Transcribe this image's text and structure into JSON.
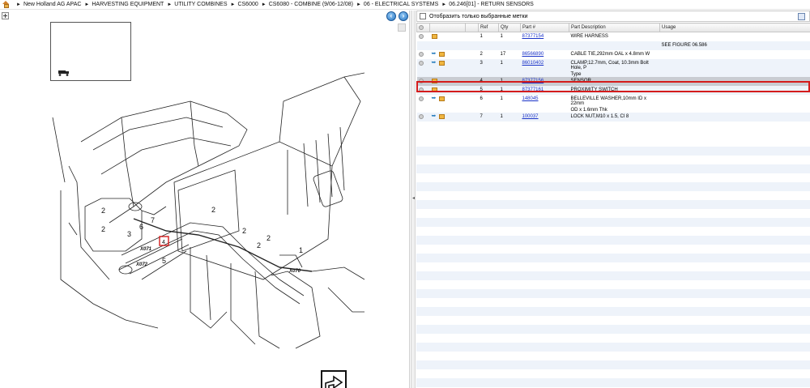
{
  "breadcrumb": [
    "New Holland AG APAC",
    "HARVESTING EQUIPMENT",
    "UTILITY COMBINES",
    "CS6000",
    "CS6080 - COMBINE (9/06-12/08)",
    "06 - ELECTRICAL SYSTEMS",
    "06.246[01] - RETURN SENSORS"
  ],
  "separator": "►",
  "nav": {
    "prev": "‹",
    "next": "›"
  },
  "filter": {
    "label": "Отобразить только выбранные метки"
  },
  "table": {
    "headers": {
      "ref": "Ref",
      "qty": "Qty",
      "part": "Part #",
      "desc": "Part Description",
      "usage": "Usage"
    },
    "rows": [
      {
        "ref": "1",
        "qty": "1",
        "part": "87377154",
        "desc": "WIRE HARNESS",
        "desc2": "",
        "wrench": false,
        "selected": false
      },
      {
        "ref": "2",
        "qty": "17",
        "part": "86566890",
        "desc": "CABLE TIE,292mm OAL x 4.8mm W",
        "desc2": "",
        "wrench": true,
        "selected": false
      },
      {
        "ref": "3",
        "qty": "1",
        "part": "86010402",
        "desc": "CLAMP,12.7mm, Coat, 10.3mm Bolt Hole, P",
        "desc2": "Type",
        "wrench": true,
        "selected": false
      },
      {
        "ref": "4",
        "qty": "1",
        "part": "87377156",
        "desc": "SENSOR",
        "desc2": "",
        "wrench": false,
        "selected": true
      },
      {
        "ref": "5",
        "qty": "1",
        "part": "87377161",
        "desc": "PROXIMITY SWITCH",
        "desc2": "",
        "wrench": false,
        "selected": false
      },
      {
        "ref": "6",
        "qty": "1",
        "part": "148045",
        "desc": "BELLEVILLE WASHER,10mm ID x 22mm",
        "desc2": "OD x 1.6mm Thk",
        "wrench": true,
        "selected": false
      },
      {
        "ref": "7",
        "qty": "1",
        "part": "100037",
        "desc": "LOCK NUT,M10 x 1.5, Cl 8",
        "desc2": "",
        "wrench": true,
        "selected": false
      }
    ],
    "see_figure_note": "SEE FIGURE 06.586"
  },
  "diagram": {
    "callouts": [
      "2",
      "2",
      "2",
      "2",
      "2",
      "2",
      "3",
      "6",
      "7",
      "4",
      "5",
      "1"
    ],
    "connector_labels": [
      "X071",
      "X072",
      "X070"
    ]
  }
}
